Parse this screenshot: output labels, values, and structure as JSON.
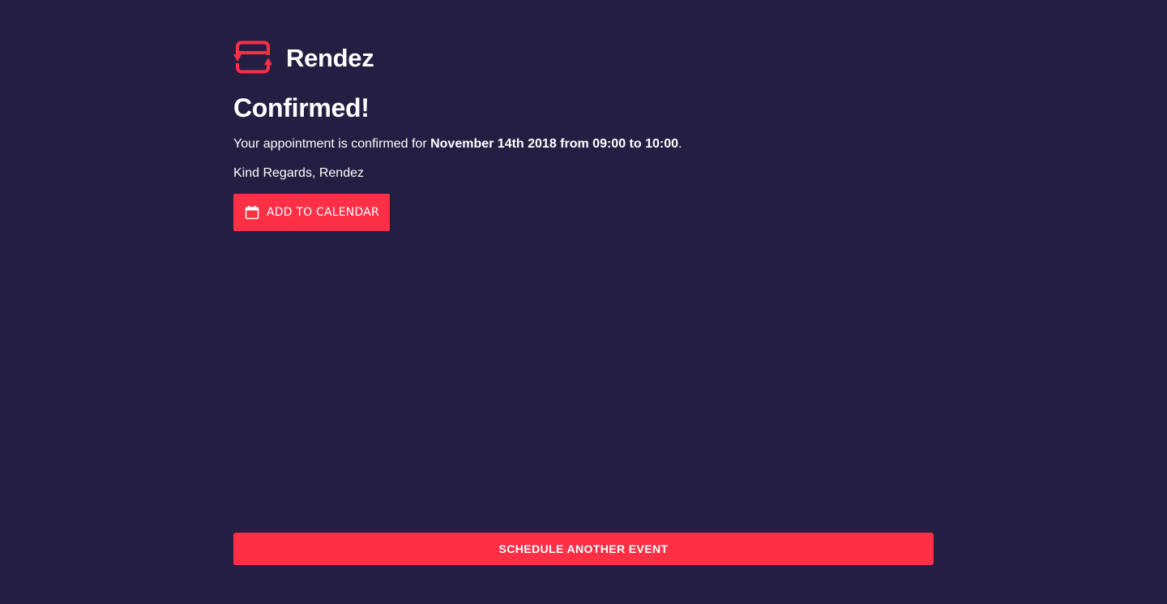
{
  "brand": {
    "name": "Rendez",
    "logo_icon": "rendez-logo-icon",
    "accent_color": "#ff2f46"
  },
  "confirmation": {
    "title": "Confirmed!",
    "message_prefix": "Your appointment is confirmed for ",
    "message_date": "November 14th 2018 from 09:00 to 10:00",
    "message_suffix": ".",
    "signoff": "Kind Regards, Rendez"
  },
  "actions": {
    "add_to_calendar": {
      "label": "ADD TO CALENDAR",
      "icon": "calendar-icon"
    },
    "schedule_another": {
      "label": "SCHEDULE ANOTHER EVENT"
    }
  },
  "colors": {
    "background": "#241e43",
    "text": "#ffffff",
    "accent": "#ff2f46"
  }
}
